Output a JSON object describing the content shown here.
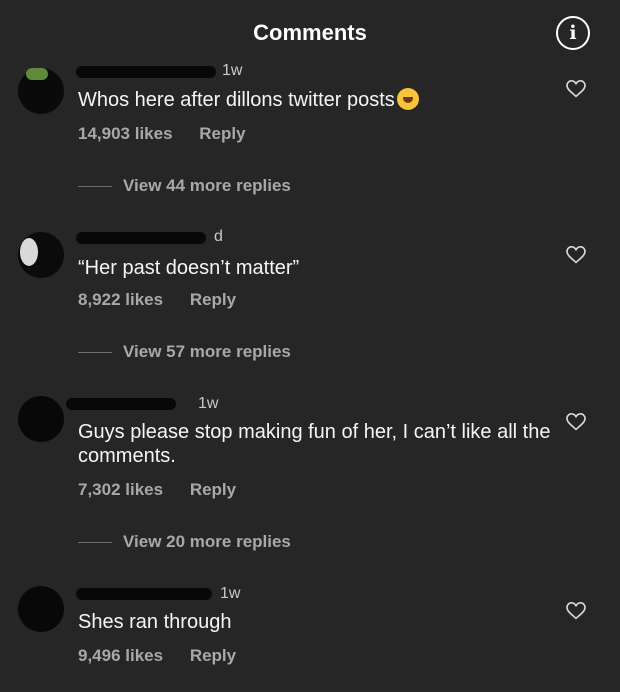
{
  "header": {
    "title": "Comments",
    "info_icon": "info-icon"
  },
  "comments": [
    {
      "time": "1w",
      "text": "Whos here after dillons twitter posts",
      "emoji": "rolling-on-floor-laughing-emoji",
      "likes": "14,903 likes",
      "reply": "Reply",
      "view_replies": "View 44 more replies"
    },
    {
      "time": "d",
      "text": "“Her past doesn’t matter”",
      "likes": "8,922 likes",
      "reply": "Reply",
      "view_replies": "View 57 more replies"
    },
    {
      "time": "1w",
      "text": "Guys please stop making fun of her, I can’t like all the comments.",
      "likes": "7,302 likes",
      "reply": "Reply",
      "view_replies": "View 20 more replies"
    },
    {
      "time": "1w",
      "text": "Shes ran through",
      "likes": "9,496 likes",
      "reply": "Reply"
    }
  ],
  "colors": {
    "background": "#262626",
    "text": "#f5f5f5",
    "secondary": "#a8a8a8"
  }
}
